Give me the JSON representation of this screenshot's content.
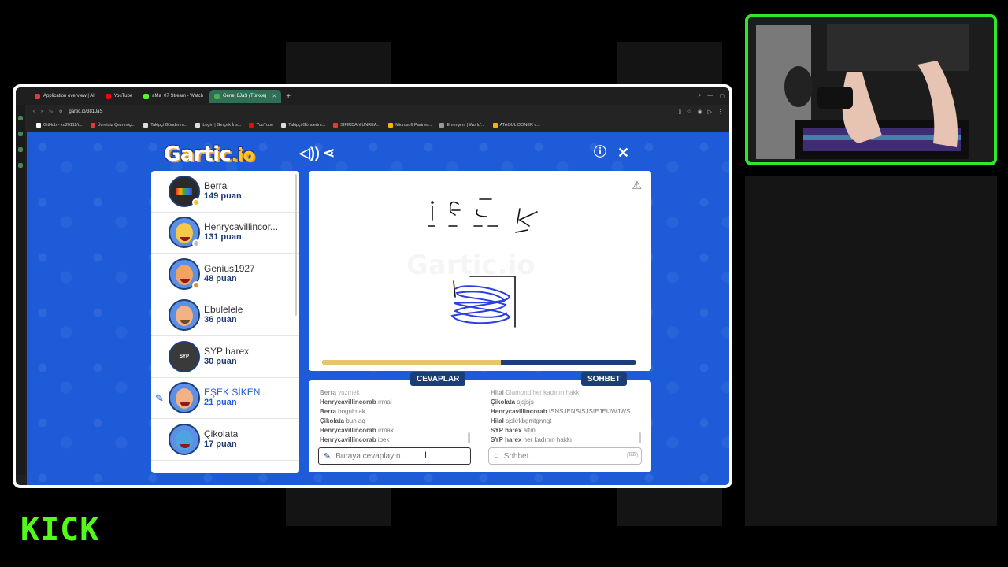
{
  "browser": {
    "tabs": [
      {
        "label": "Application overview | Al",
        "color": "#e53935",
        "active": false
      },
      {
        "label": "YouTube",
        "color": "#ff0000",
        "active": false
      },
      {
        "label": "aMa_07 Stream - Watch",
        "color": "#53fc18",
        "active": false
      },
      {
        "label": "Genel 8JaS (Türkçe)",
        "color": "#4caf50",
        "active": true
      }
    ],
    "url": "gartic.io/381JaS",
    "bookmarks": [
      "GitHub - xd20111/i...",
      "Ücretsiz Çevrimiçi...",
      "Takipçi Gönderim...",
      "Login | Gerçek İns...",
      "YouTube",
      "Takipçi Gönderim...",
      "SIFIRDAN UNREA...",
      "Microsoft Partner...",
      "Emergent | World'...",
      "ATAGUL DONER c..."
    ]
  },
  "game": {
    "logo_main": "Gartic",
    "logo_io": ".io",
    "players": [
      {
        "name": "Berra",
        "score": "149 puan",
        "skin": "#2a2a2a",
        "status": "#f6c21c",
        "drawer": false
      },
      {
        "name": "Henrycavillincor...",
        "score": "131 puan",
        "skin": "#f7c948",
        "status": "#bdbdbd",
        "drawer": false
      },
      {
        "name": "Genius1927",
        "score": "48 puan",
        "skin": "#f4a261",
        "status": "#f08a24",
        "drawer": false
      },
      {
        "name": "Ebulelele",
        "score": "36 puan",
        "skin": "#f4b183",
        "status": "",
        "drawer": false
      },
      {
        "name": "SYP harex",
        "score": "30 puan",
        "skin": "#3a3a3a",
        "status": "",
        "drawer": false
      },
      {
        "name": "EŞEK SİKEN",
        "score": "21 puan",
        "skin": "#f4b183",
        "status": "",
        "drawer": true
      },
      {
        "name": "Çikolata",
        "score": "17 puan",
        "skin": "#4fa3e0",
        "status": "",
        "drawer": false
      }
    ],
    "timer_progress": 0.57,
    "answers_tab": "CEVAPLAR",
    "chat_tab": "SOHBET",
    "answers": [
      {
        "user": "Berra",
        "text": "yuzmek"
      },
      {
        "user": "Henrycavillincorab",
        "text": "ırmal"
      },
      {
        "user": "Berra",
        "text": "bogulmak"
      },
      {
        "user": "Çikolata",
        "text": "bun aq"
      },
      {
        "user": "Henrycavillincorab",
        "text": "ırmak"
      },
      {
        "user": "Henrycavillincorab",
        "text": "ipek"
      }
    ],
    "chat": [
      {
        "user": "Hilal",
        "text": "Diamond her kadının hakkı"
      },
      {
        "user": "Çikolata",
        "text": "sjsjsjs"
      },
      {
        "user": "Henrycavillincorab",
        "text": "ISNSJENSISJSIEJEIJWJWS"
      },
      {
        "user": "Hilal",
        "text": "sjskrkbgmtgnngt"
      },
      {
        "user": "SYP harex",
        "text": "altın"
      },
      {
        "user": "SYP harex",
        "text": "her kadının hakkı"
      }
    ],
    "answer_placeholder": "Buraya cevaplayın...",
    "chat_placeholder": "Sohbet...",
    "tab_key": "tab",
    "icons": {
      "sound": "sound-icon",
      "share": "share-icon",
      "info": "info-icon",
      "close": "close-icon",
      "report": "warning-icon",
      "pencil": "pencil-icon",
      "search": "search-icon"
    }
  },
  "brand": {
    "kick_logo": "KICK",
    "kick_color": "#53fc18"
  }
}
